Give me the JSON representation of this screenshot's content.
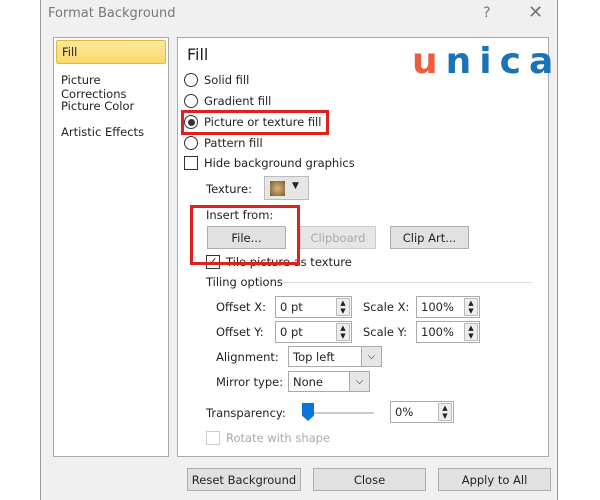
{
  "window": {
    "title": "Format Background",
    "help": "?",
    "close": "✕"
  },
  "nav": {
    "items": [
      {
        "label": "Fill",
        "selected": true
      },
      {
        "label": "Picture Corrections"
      },
      {
        "label": "Picture Color"
      },
      {
        "label": "Artistic Effects"
      }
    ]
  },
  "panel": {
    "heading": "Fill",
    "logo": {
      "text_u": "u",
      "text_rest": "nica",
      "colors": {
        "u": "#ee5b3f",
        "rest": "#1a73b8"
      }
    },
    "fill_options": [
      {
        "label": "Solid fill",
        "checked": false
      },
      {
        "label": "Gradient fill",
        "checked": false
      },
      {
        "label": "Picture or texture fill",
        "checked": true
      },
      {
        "label": "Pattern fill",
        "checked": false
      }
    ],
    "hide_background": {
      "label": "Hide background graphics",
      "checked": false
    },
    "texture_label": "Texture:",
    "insert_from": "Insert from:",
    "buttons": {
      "file": "File...",
      "clipboard": "Clipboard",
      "clip_art": "Clip Art..."
    },
    "tile": {
      "label": "Tile picture as texture",
      "checked": true
    },
    "tiling_options": "Tiling options",
    "offset_x": {
      "label": "Offset X:",
      "value": "0 pt"
    },
    "offset_y": {
      "label": "Offset Y:",
      "value": "0 pt"
    },
    "scale_x": {
      "label": "Scale X:",
      "value": "100%"
    },
    "scale_y": {
      "label": "Scale Y:",
      "value": "100%"
    },
    "alignment": {
      "label": "Alignment:",
      "value": "Top left"
    },
    "mirror": {
      "label": "Mirror type:",
      "value": "None"
    },
    "transparency": {
      "label": "Transparency:",
      "value": "0%",
      "level": 0
    },
    "rotate": {
      "label": "Rotate with shape",
      "checked": false,
      "disabled": true
    }
  },
  "footer": {
    "reset": "Reset Background",
    "close": "Close",
    "apply_all": "Apply to All"
  },
  "highlight_color": "#e0201c"
}
